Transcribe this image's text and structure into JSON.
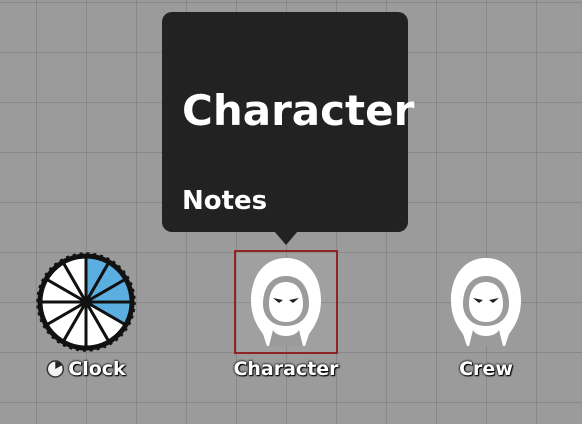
{
  "tooltip": {
    "title": "Character",
    "section": "Notes"
  },
  "tokens": [
    {
      "label": "Clock",
      "icon": "progress-clock-icon",
      "segments": 12,
      "filled": 4,
      "fill_color": "#5aaee0"
    },
    {
      "label": "Character",
      "icon": "hooded-figure-icon",
      "selected": true
    },
    {
      "label": "Crew",
      "icon": "hooded-figure-icon"
    }
  ],
  "colors": {
    "canvas": "#9b9b9b",
    "tooltip_bg": "#222222",
    "selection_border": "#8f2424"
  }
}
